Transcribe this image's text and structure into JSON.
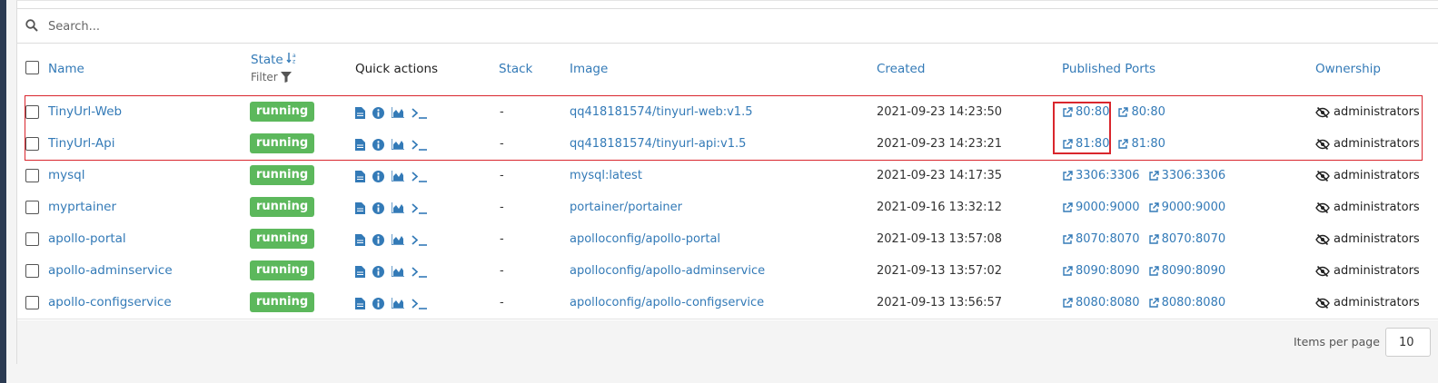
{
  "search": {
    "placeholder": "Search..."
  },
  "table": {
    "headers": {
      "name": "Name",
      "state": "State",
      "filter": "Filter",
      "quick_actions": "Quick actions",
      "stack": "Stack",
      "image": "Image",
      "created": "Created",
      "published_ports": "Published Ports",
      "ownership": "Ownership"
    },
    "rows": [
      {
        "name": "TinyUrl-Web",
        "state": "running",
        "stack": "-",
        "image": "qq418181574/tinyurl-web:v1.5",
        "created": "2021-09-23 14:23:50",
        "ports": [
          "80:80",
          "80:80"
        ],
        "ownership": "administrators"
      },
      {
        "name": "TinyUrl-Api",
        "state": "running",
        "stack": "-",
        "image": "qq418181574/tinyurl-api:v1.5",
        "created": "2021-09-23 14:23:21",
        "ports": [
          "81:80",
          "81:80"
        ],
        "ownership": "administrators"
      },
      {
        "name": "mysql",
        "state": "running",
        "stack": "-",
        "image": "mysql:latest",
        "created": "2021-09-23 14:17:35",
        "ports": [
          "3306:3306",
          "3306:3306"
        ],
        "ownership": "administrators"
      },
      {
        "name": "myprtainer",
        "state": "running",
        "stack": "-",
        "image": "portainer/portainer",
        "created": "2021-09-16 13:32:12",
        "ports": [
          "9000:9000",
          "9000:9000"
        ],
        "ownership": "administrators"
      },
      {
        "name": "apollo-portal",
        "state": "running",
        "stack": "-",
        "image": "apolloconfig/apollo-portal",
        "created": "2021-09-13 13:57:08",
        "ports": [
          "8070:8070",
          "8070:8070"
        ],
        "ownership": "administrators"
      },
      {
        "name": "apollo-adminservice",
        "state": "running",
        "stack": "-",
        "image": "apolloconfig/apollo-adminservice",
        "created": "2021-09-13 13:57:02",
        "ports": [
          "8090:8090",
          "8090:8090"
        ],
        "ownership": "administrators"
      },
      {
        "name": "apollo-configservice",
        "state": "running",
        "stack": "-",
        "image": "apolloconfig/apollo-configservice",
        "created": "2021-09-13 13:56:57",
        "ports": [
          "8080:8080",
          "8080:8080"
        ],
        "ownership": "administrators"
      }
    ]
  },
  "pagination": {
    "items_per_page_label": "Items per page",
    "items_per_page_value": "10"
  },
  "icons": {
    "search": "search-icon",
    "sort": "sort-alpha-icon",
    "filter": "filter-icon",
    "logs": "file-text-icon",
    "inspect": "info-circle-icon",
    "stats": "area-chart-icon",
    "console": "terminal-icon",
    "port_link": "external-link-icon",
    "ownership": "eye-slash-icon"
  },
  "colors": {
    "link": "#337ab7",
    "running": "#5cb85c",
    "annotation": "#d9262d"
  }
}
